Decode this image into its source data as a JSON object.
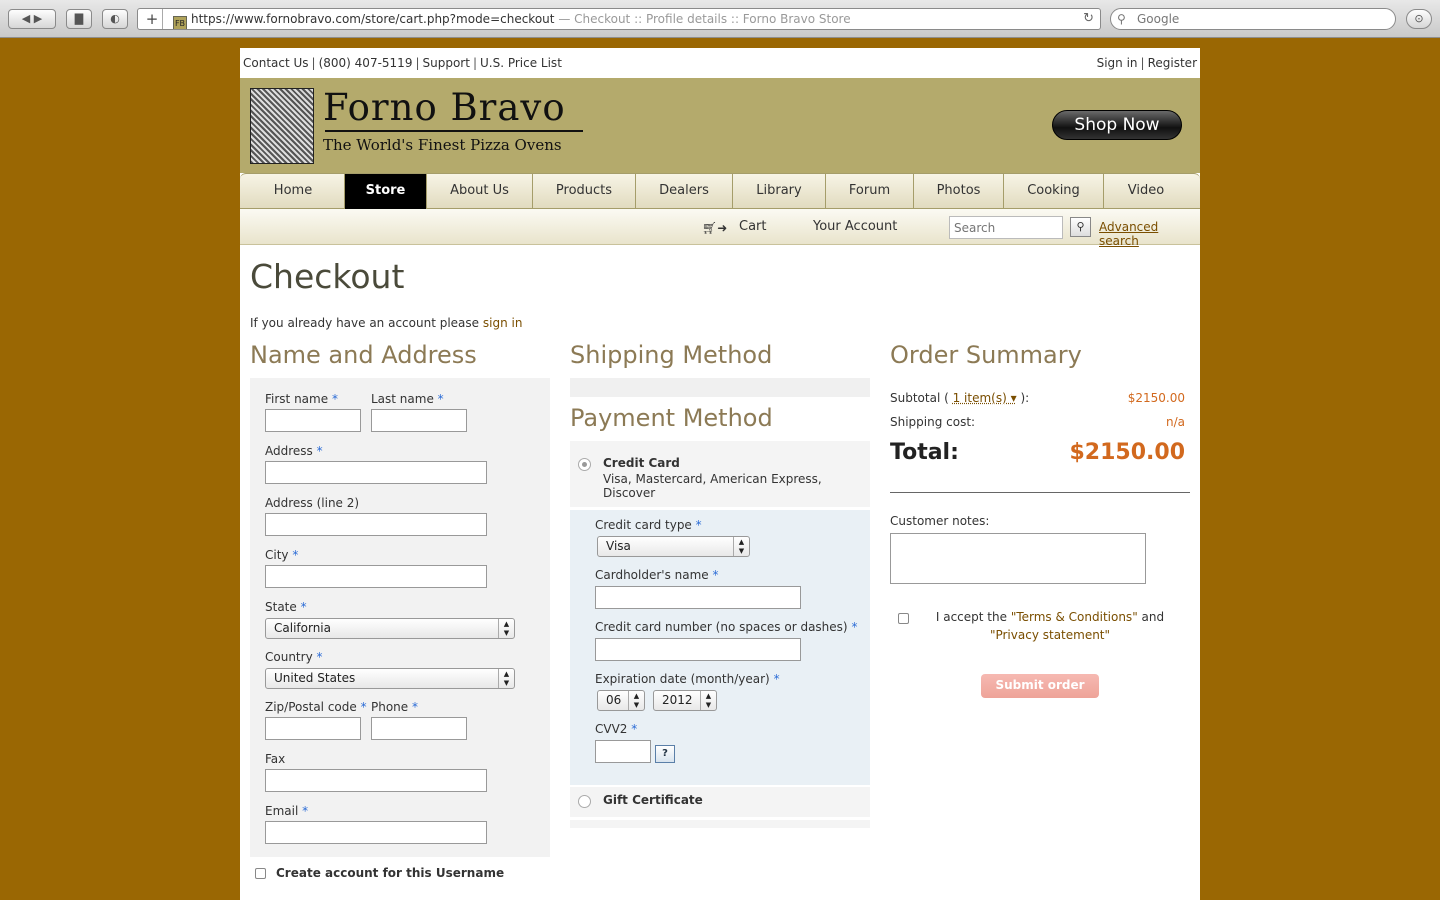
{
  "browser": {
    "url": "https://www.fornobravo.com/store/cart.php?mode=checkout",
    "page_title": "— Checkout :: Profile details :: Forno Bravo Store",
    "favicon_text": "FB",
    "search_placeholder": "Google"
  },
  "topbar": {
    "contact": "Contact Us",
    "phone": "(800) 407-5119",
    "support": "Support",
    "price_list": "U.S. Price List",
    "sign_in": "Sign in",
    "register": "Register",
    "separator": "|"
  },
  "banner": {
    "title": "Forno Bravo",
    "tagline": "The World's Finest Pizza Ovens",
    "shop_now": "Shop Now"
  },
  "nav": {
    "tabs": [
      {
        "label": "Home",
        "width": 103
      },
      {
        "label": "Store",
        "width": 82
      },
      {
        "label": "About Us",
        "width": 106
      },
      {
        "label": "Products",
        "width": 103
      },
      {
        "label": "Dealers",
        "width": 97
      },
      {
        "label": "Library",
        "width": 93
      },
      {
        "label": "Forum",
        "width": 88
      },
      {
        "label": "Photos",
        "width": 90
      },
      {
        "label": "Cooking",
        "width": 100
      },
      {
        "label": "Video",
        "width": 84
      }
    ],
    "active": "Store"
  },
  "subnav": {
    "cart": "Cart",
    "account": "Your Account",
    "search_placeholder": "Search",
    "advanced_search": "Advanced search"
  },
  "checkout": {
    "title": "Checkout",
    "intro": "If you already have an account please",
    "sign_in_link": "sign in"
  },
  "address": {
    "heading": "Name and Address",
    "required_mark": "*",
    "first_name": "First name",
    "last_name": "Last name",
    "address": "Address",
    "address2": "Address (line 2)",
    "city": "City",
    "state": "State",
    "state_value": "California",
    "country": "Country",
    "country_value": "United States",
    "zip": "Zip/Postal code",
    "phone": "Phone",
    "fax": "Fax",
    "email": "Email",
    "create_account": "Create account for this Username"
  },
  "shipping": {
    "heading": "Shipping Method"
  },
  "payment": {
    "heading": "Payment Method",
    "credit_card": "Credit Card",
    "credit_card_desc": "Visa, Mastercard, American Express, Discover",
    "card_type": "Credit card type",
    "card_type_value": "Visa",
    "cardholder": "Cardholder's name",
    "card_number": "Credit card number (no spaces or dashes)",
    "expiration": "Expiration date (month/year)",
    "exp_month": "06",
    "exp_year": "2012",
    "cvv": "CVV2",
    "cvv_help": "?",
    "gift_certificate": "Gift Certificate"
  },
  "summary": {
    "heading": "Order Summary",
    "subtotal_label": "Subtotal (",
    "items_link": "1 item(s)",
    "subtotal_close": "):",
    "subtotal_value": "$2150.00",
    "shipping_label": "Shipping cost:",
    "shipping_value": "n/a",
    "total_label": "Total:",
    "total_value": "$2150.00",
    "notes_label": "Customer notes:",
    "accept_prefix": "I accept the",
    "terms": "\"Terms & Conditions\"",
    "and": "and",
    "privacy": "\"Privacy statement\"",
    "submit": "Submit order"
  }
}
